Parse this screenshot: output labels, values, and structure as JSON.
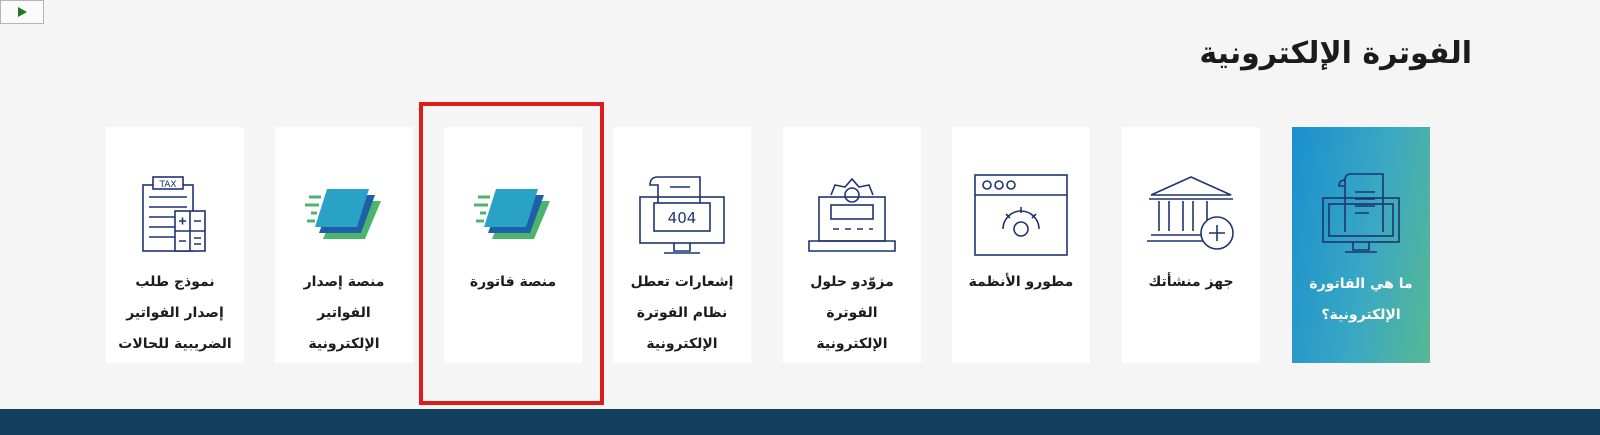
{
  "colors": {
    "highlight": "#dd1c1c",
    "active_card_gradient": [
      "#1a8fce",
      "#58b894"
    ],
    "footer": "#123f5e",
    "icon_stroke": "#1f3470"
  },
  "player": {
    "icon": "play-icon"
  },
  "section": {
    "title": "الفوترة الإلكترونية"
  },
  "cards": [
    {
      "label": "ما هي الفاتورة\nالإلكترونية؟",
      "icon": "invoice-monitor-icon",
      "active": true
    },
    {
      "label": "جهز منشأتك",
      "icon": "institution-plus-icon"
    },
    {
      "label": "مطورو الأنظمة",
      "icon": "browser-gear-icon"
    },
    {
      "label": "مزوّدو حلول\nالفوترة\nالإلكترونية",
      "icon": "gear-device-icon"
    },
    {
      "label": "إشعارات تعطل\nنظام الفوترة\nالإلكترونية",
      "icon": "error-404-monitor-icon",
      "code": "404"
    },
    {
      "label": "منصة فاتورة",
      "icon": "fatoora-logo-icon",
      "highlighted": true
    },
    {
      "label": "منصة إصدار\nالفواتير\nالإلكترونية",
      "icon": "fatoora-logo-icon"
    },
    {
      "label": "نموذج طلب\nإصدار الفواتير\nالضريبية للحالات\nالخاصة",
      "icon": "tax-form-calculator-icon",
      "badge": "TAX"
    }
  ]
}
